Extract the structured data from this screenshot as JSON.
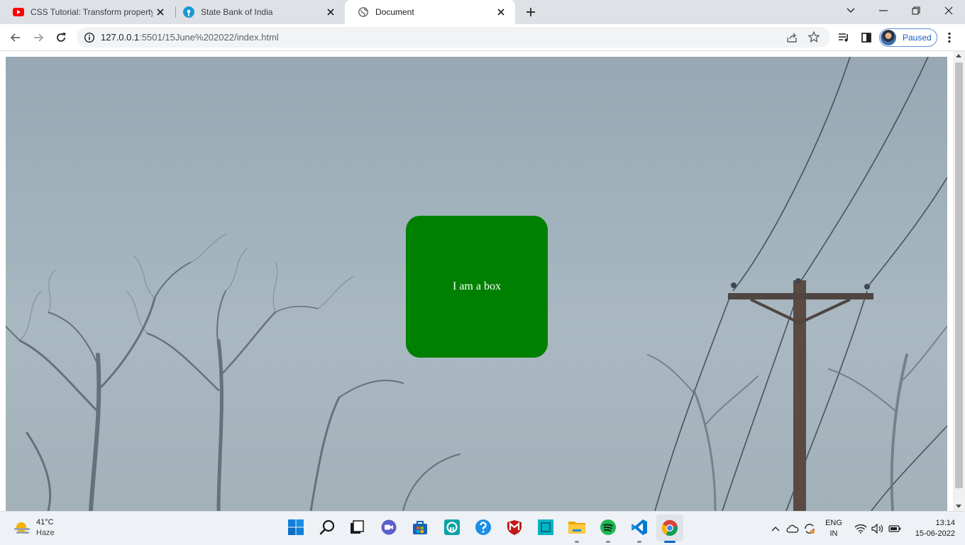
{
  "browser": {
    "tabs": [
      {
        "title": "CSS Tutorial: Transform property",
        "favicon": "youtube-icon",
        "active": false
      },
      {
        "title": "State Bank of India",
        "favicon": "sbi-icon",
        "active": false
      },
      {
        "title": "Document",
        "favicon": "globe-icon",
        "active": true
      }
    ],
    "address": {
      "host": "127.0.0.1",
      "path": ":5501/15June%202022/index.html"
    },
    "profile_label": "Paused"
  },
  "page": {
    "box_text": "I am a box",
    "box_color": "#008000"
  },
  "taskbar": {
    "weather": {
      "temp": "41°C",
      "condition": "Haze"
    },
    "apps": [
      "start-icon",
      "search-icon",
      "task-view-icon",
      "teams-chat-icon",
      "store-icon",
      "app-icon",
      "help-icon",
      "mcafee-icon",
      "app-icon",
      "file-explorer-icon",
      "spotify-icon",
      "vscode-icon",
      "chrome-icon"
    ],
    "language": {
      "line1": "ENG",
      "line2": "IN"
    },
    "clock": {
      "time": "13:14",
      "date": "15-06-2022"
    }
  }
}
